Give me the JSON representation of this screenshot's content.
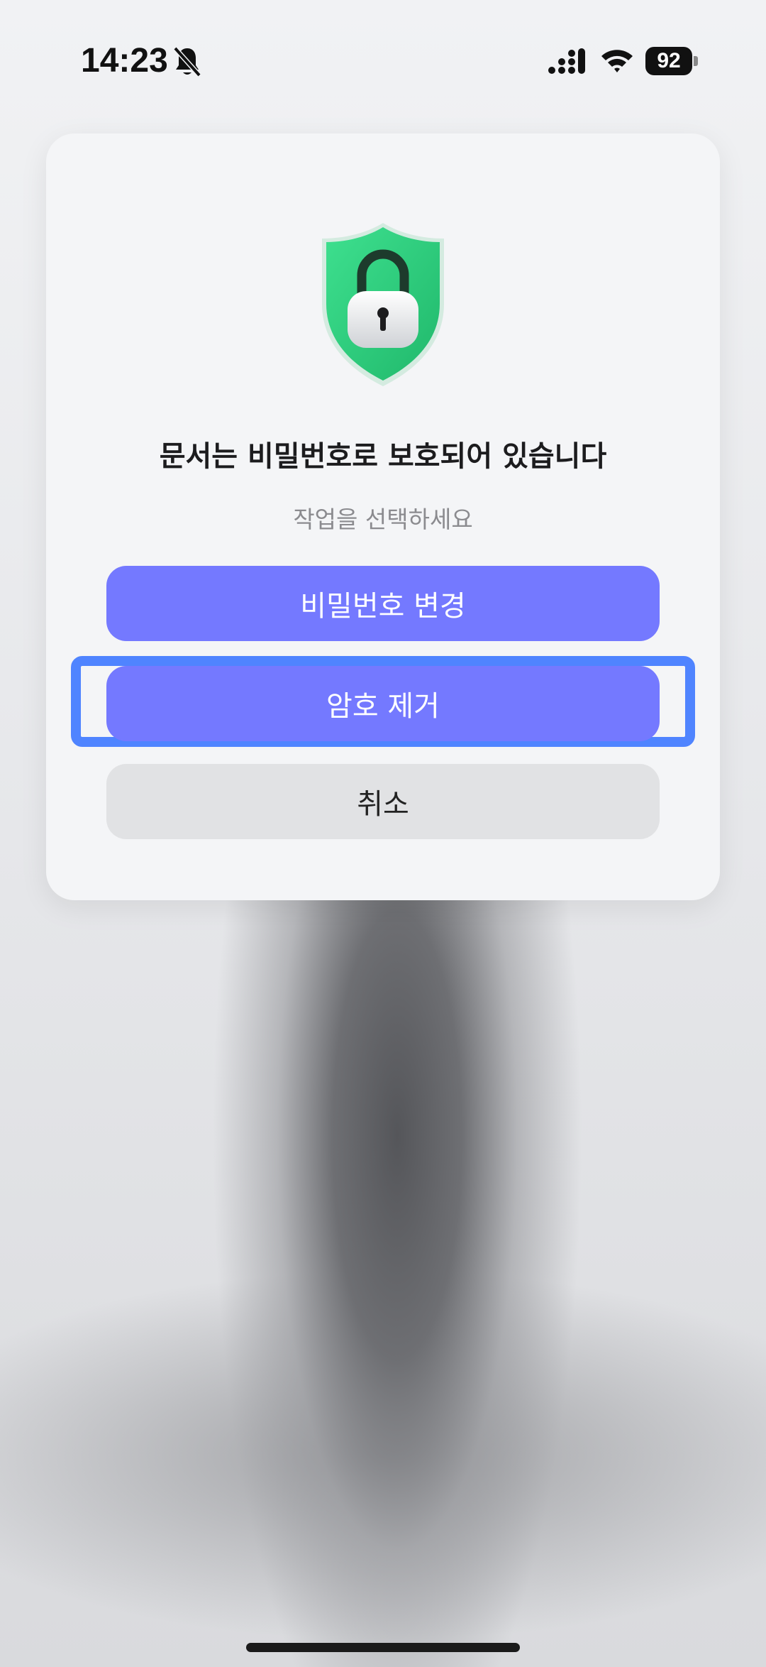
{
  "status_bar": {
    "time": "14:23",
    "battery": "92",
    "icons": [
      "bell-slash-icon",
      "cellular-signal-icon",
      "wifi-icon",
      "battery-icon"
    ]
  },
  "dialog": {
    "icon": "shield-lock-icon",
    "title": "문서는 비밀번호로 보호되어 있습니다",
    "subtitle": "작업을 선택하세요",
    "buttons": {
      "change_password": "비밀번호 변경",
      "remove_password": "암호 제거",
      "cancel": "취소"
    }
  },
  "colors": {
    "primary_button": "#7479ff",
    "cancel_button": "#e1e2e4",
    "highlight": "#4f84ff",
    "shield": "#2ecc7f"
  }
}
